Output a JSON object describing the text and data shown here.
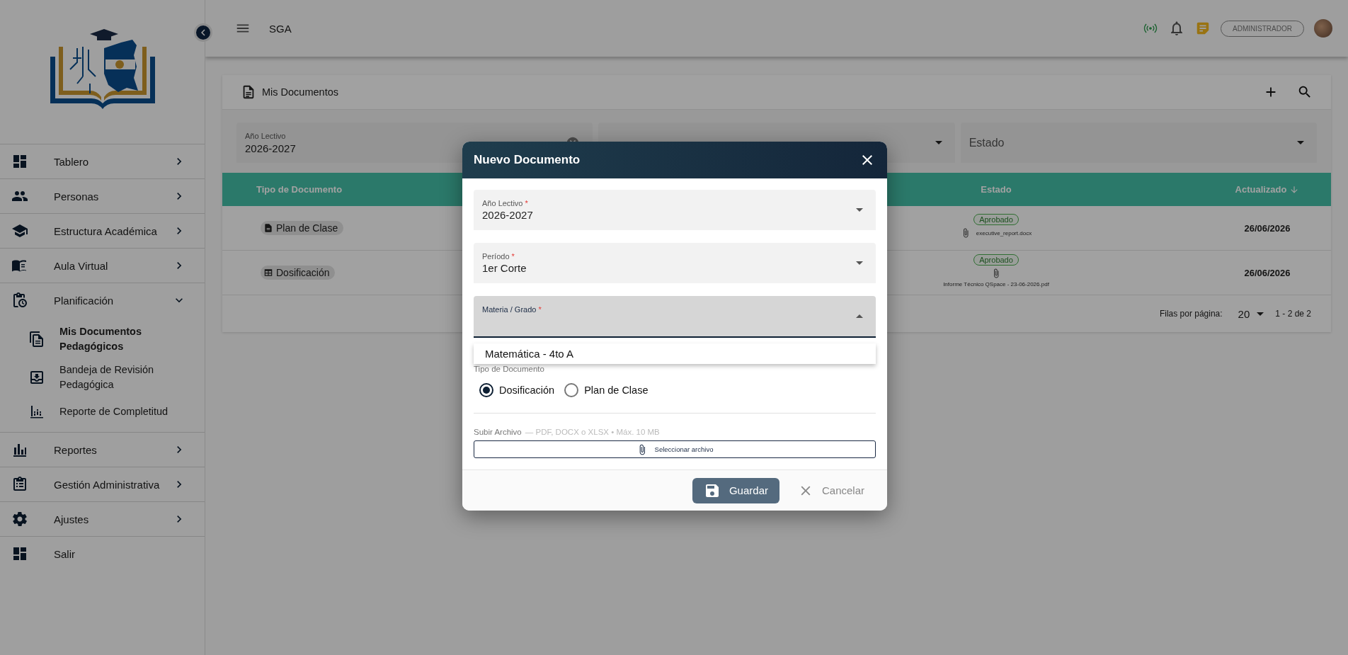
{
  "topbar": {
    "title": "SGA",
    "role_button": "ADMINISTRADOR"
  },
  "sidebar": {
    "items": [
      {
        "label": "Tablero",
        "kind": "group",
        "expanded": false
      },
      {
        "label": "Personas",
        "kind": "group",
        "expanded": false
      },
      {
        "label": "Estructura Académica",
        "kind": "group",
        "expanded": false
      },
      {
        "label": "Aula Virtual",
        "kind": "group",
        "expanded": false
      },
      {
        "label": "Planificación",
        "kind": "group",
        "expanded": true,
        "children": [
          {
            "label": "Mis Documentos Pedagógicos",
            "selected": true
          },
          {
            "label": "Bandeja de Revisión Pedagógica",
            "selected": false
          },
          {
            "label": "Reporte de Completitud",
            "selected": false
          }
        ]
      },
      {
        "label": "Reportes",
        "kind": "group",
        "expanded": false
      },
      {
        "label": "Gestión Administrativa",
        "kind": "group",
        "expanded": false
      },
      {
        "label": "Ajustes",
        "kind": "group",
        "expanded": false
      },
      {
        "label": "Salir",
        "kind": "link"
      }
    ]
  },
  "card": {
    "title": "Mis Documentos",
    "filters": [
      {
        "label": "Año Lectivo",
        "value": "2026-2027",
        "clearable": true
      },
      {
        "clearable": false
      },
      {
        "label": "Estado",
        "clearable": false
      }
    ],
    "table": {
      "columns": [
        {
          "label": "Tipo de Documento"
        },
        {
          "label": "Estado"
        },
        {
          "label": "Actualizado",
          "sorted": true
        }
      ],
      "rows": [
        {
          "type": "Plan de Clase",
          "status": "Aprobado",
          "file": "executive_report.docx",
          "updated": "26/06/2026"
        },
        {
          "type": "Dosificación",
          "status": "Aprobado",
          "file": "Informe Técnico QSpace - 23-06-2026.pdf",
          "updated": "26/06/2026"
        }
      ]
    },
    "pagination": {
      "rows_label": "Filas por página:",
      "rows_value": "20",
      "range": "1 - 2 de 2"
    }
  },
  "dialog": {
    "title": "Nuevo Documento",
    "fields": [
      {
        "label": "Año Lectivo",
        "required_mark": "*",
        "value": "2026-2027",
        "open": false
      },
      {
        "label": "Período",
        "required_mark": "*",
        "value": "1er Corte",
        "open": false
      },
      {
        "label": "Materia / Grado",
        "required_mark": "*",
        "open": true
      }
    ],
    "options": [
      {
        "label": "Matemática - 4to A",
        "selected": false
      }
    ],
    "doc_type": {
      "label": "Tipo de Documento",
      "options": [
        {
          "label": "Dosificación",
          "selected": true
        },
        {
          "label": "Plan de Clase",
          "selected": false
        }
      ]
    },
    "upload": {
      "label": "Subir Archivo",
      "hint": "— PDF, DOCX o XLSX • Máx. 10 MB",
      "button": "Seleccionar archivo"
    },
    "buttons": {
      "save": "Guardar",
      "cancel": "Cancelar"
    }
  }
}
